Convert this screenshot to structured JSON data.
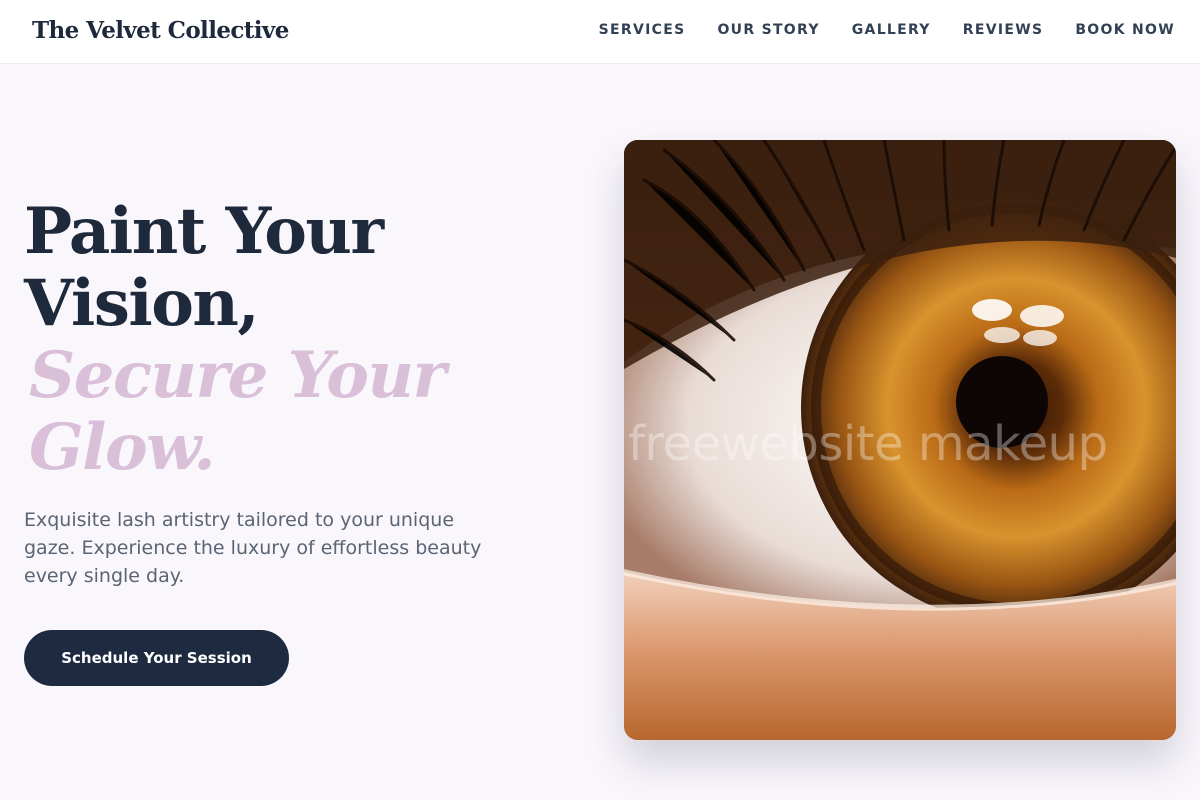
{
  "header": {
    "brand": "The Velvet Collective",
    "nav": [
      {
        "label": "SERVICES"
      },
      {
        "label": "OUR STORY"
      },
      {
        "label": "GALLERY"
      },
      {
        "label": "REVIEWS"
      },
      {
        "label": "BOOK NOW"
      }
    ]
  },
  "hero": {
    "headline_line1": "Paint Your",
    "headline_line2": "Vision,",
    "headline_accent_line1": "Secure Your",
    "headline_accent_line2": "Glow.",
    "description": "Exquisite lash artistry tailored to your unique gaze. Experience the luxury of effortless beauty every single day.",
    "cta_label": "Schedule Your Session",
    "image_watermark": "freewebsite makeup"
  },
  "colors": {
    "primary_dark": "#1e293b",
    "accent_mauve": "#d9bfd8",
    "button_bg": "#1e2a3f",
    "page_bg": "#f9f7fc"
  }
}
